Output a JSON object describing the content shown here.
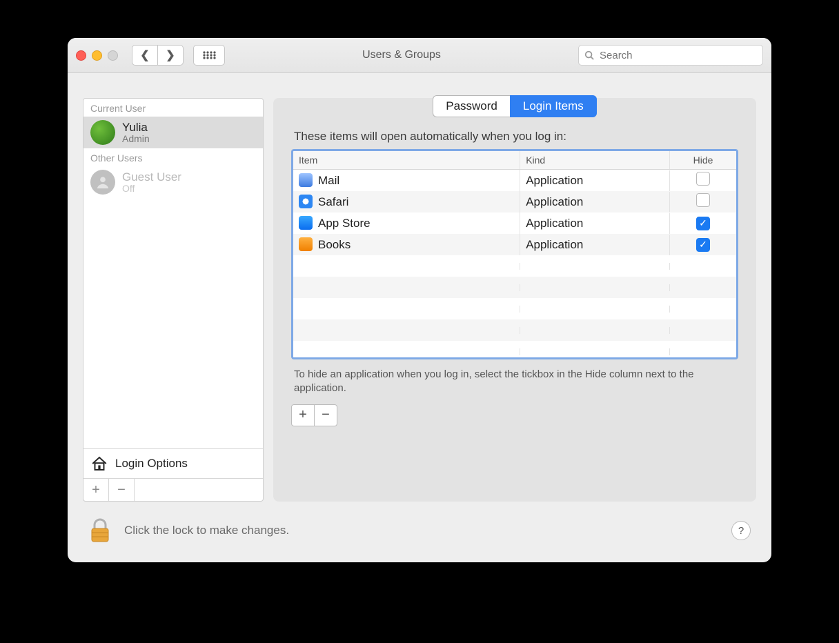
{
  "window": {
    "title": "Users & Groups"
  },
  "search": {
    "placeholder": "Search"
  },
  "sidebar": {
    "current_header": "Current User",
    "other_header": "Other Users",
    "current": {
      "name": "Yulia",
      "role": "Admin"
    },
    "guest": {
      "name": "Guest User",
      "role": "Off"
    },
    "login_options": "Login Options"
  },
  "tabs": {
    "password": "Password",
    "login_items": "Login Items"
  },
  "intro": "These items will open automatically when you log in:",
  "columns": {
    "item": "Item",
    "kind": "Kind",
    "hide": "Hide"
  },
  "items": [
    {
      "name": "Mail",
      "kind": "Application",
      "hide": false,
      "icon": "ic-mail"
    },
    {
      "name": "Safari",
      "kind": "Application",
      "hide": false,
      "icon": "ic-safari"
    },
    {
      "name": "App Store",
      "kind": "Application",
      "hide": true,
      "icon": "ic-appstore"
    },
    {
      "name": "Books",
      "kind": "Application",
      "hide": true,
      "icon": "ic-books"
    }
  ],
  "hint": "To hide an application when you log in, select the tickbox in the Hide column next to the application.",
  "lock_text": "Click the lock to make changes."
}
